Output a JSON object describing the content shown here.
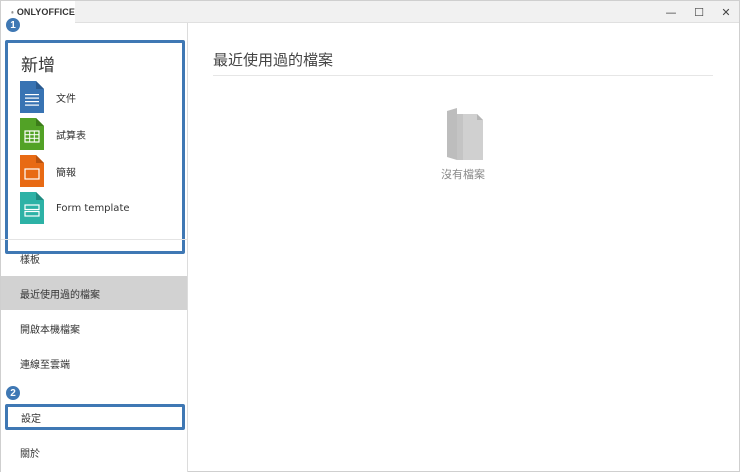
{
  "app": {
    "tab_title": "ONLYOFFICE"
  },
  "window_controls": {
    "minimize": "—",
    "maximize": "☐",
    "close": "✕"
  },
  "sidebar": {
    "new_section": {
      "title": "新增",
      "items": [
        {
          "label": "文件",
          "icon": "document-icon",
          "color": "#3873b3"
        },
        {
          "label": "試算表",
          "icon": "spreadsheet-icon",
          "color": "#52a226"
        },
        {
          "label": "簡報",
          "icon": "presentation-icon",
          "color": "#e86a14"
        },
        {
          "label": "Form template",
          "icon": "form-template-icon",
          "color": "#2db2a6"
        }
      ]
    },
    "nav_items": [
      {
        "label": "樣板"
      },
      {
        "label": "最近使用過的檔案",
        "active": true
      },
      {
        "label": "開啟本機檔案"
      },
      {
        "label": "連線至雲端"
      },
      {
        "label": "設定"
      },
      {
        "label": "關於"
      }
    ],
    "badges": {
      "first": "1",
      "second": "2"
    }
  },
  "main": {
    "title": "最近使用過的檔案",
    "empty_text": "沒有檔案",
    "empty_icon": "empty-file-icon"
  },
  "colors": {
    "accent": "#3f78b4",
    "active_bg": "#d2d2d2"
  }
}
